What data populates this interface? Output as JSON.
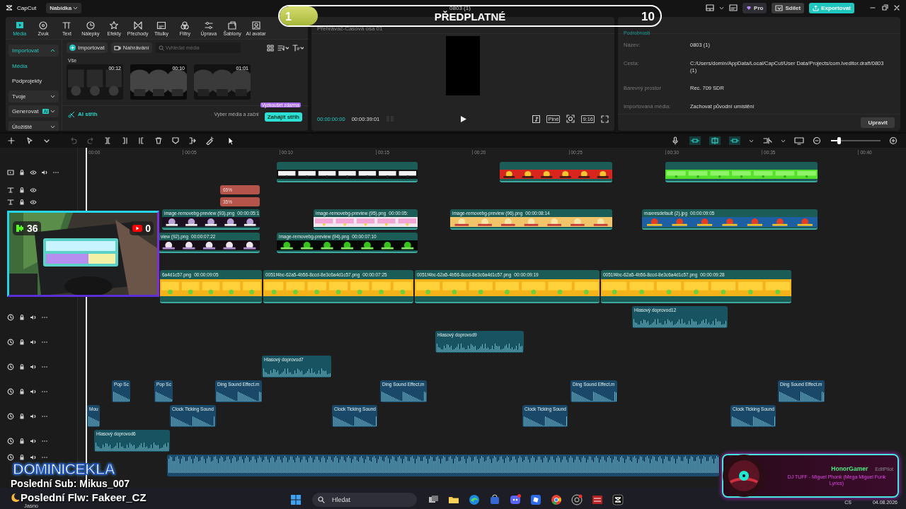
{
  "titlebar": {
    "app": "CapCut",
    "menu": "Nabídka",
    "project": "0803 (1)",
    "pro": "Pro",
    "share": "Sdílet",
    "export": "Exportovat"
  },
  "tool_tabs": [
    {
      "label": "Média",
      "selected": true
    },
    {
      "label": "Zvuk",
      "selected": false
    },
    {
      "label": "Text",
      "selected": false
    },
    {
      "label": "Nálepky",
      "selected": false
    },
    {
      "label": "Efekty",
      "selected": false
    },
    {
      "label": "Přechody",
      "selected": false
    },
    {
      "label": "Titulky",
      "selected": false
    },
    {
      "label": "Filtry",
      "selected": false
    },
    {
      "label": "Úprava",
      "selected": false
    },
    {
      "label": "Šablony",
      "selected": false
    },
    {
      "label": "AI avatar",
      "selected": false
    }
  ],
  "media_sidebar": [
    {
      "label": "Importovat",
      "kind": "group",
      "expanded": true
    },
    {
      "label": "Média",
      "kind": "item",
      "selected": true
    },
    {
      "label": "Podprojekty",
      "kind": "item",
      "selected": false
    },
    {
      "label": "Tvoje",
      "kind": "group",
      "expanded": false
    },
    {
      "label": "Generovat",
      "kind": "group",
      "expanded": false,
      "badge": "AI"
    },
    {
      "label": "Úložiště",
      "kind": "group",
      "expanded": false
    }
  ],
  "media_toolbar": {
    "import": "Importovat",
    "record": "Nahrávání",
    "search_placeholder": "Vyhledat média"
  },
  "media_filter": "Vše",
  "media_items": [
    {
      "duration": "00:12"
    },
    {
      "duration": "00:10"
    },
    {
      "duration": "01:01"
    }
  ],
  "ai_cut": {
    "label": "AI střih",
    "hint": "Vyber média a začni",
    "button": "Zahájit střih",
    "badge": "Vyzkoušet zdarma"
  },
  "player": {
    "title": "Přehrávač-Časová osa 01",
    "current_time": "00:00:00:00",
    "total_time": "00:00:39:01",
    "fit": "Plné",
    "ratio": "9:16"
  },
  "details": {
    "tab": "Podrobnosti",
    "rows": [
      {
        "label": "Název:",
        "value": "0803 (1)"
      },
      {
        "label": "Cesta:",
        "value": "C:/Users/domin/AppData/Local/CapCut/User Data/Projects/com.lveditor.draft/0803 (1)"
      },
      {
        "label": "Barevný prostor",
        "value": "Rec. 709 SDR"
      },
      {
        "label": "Importovaná média:",
        "value": "Zachovat původní umístění"
      }
    ],
    "edit_button": "Upravit"
  },
  "zoom_slider": {
    "level": 0.15
  },
  "ruler": [
    "00:00",
    "00:05",
    "00:10",
    "00:15",
    "00:20",
    "00:25",
    "00:30",
    "00:35",
    "00:40"
  ],
  "tracks": [
    {
      "kind": "video",
      "clips": [
        {
          "kind": "video"
        },
        {
          "kind": "video"
        },
        {
          "kind": "video"
        }
      ]
    },
    {
      "kind": "text",
      "clips": [
        {
          "kind": "text",
          "label": "65%"
        }
      ]
    },
    {
      "kind": "text",
      "clips": [
        {
          "kind": "text",
          "label": "35%"
        }
      ]
    },
    {
      "kind": "video",
      "clips": [
        {
          "kind": "video",
          "label": "image-removebg-preview (93).png",
          "duration": "00:00:05:1"
        },
        {
          "kind": "video",
          "label": "image-removebg-preview (95).png",
          "duration": "00:00:05:"
        },
        {
          "kind": "video",
          "label": "image-removebg-preview (96).png",
          "duration": "00:00:08:14"
        },
        {
          "kind": "video",
          "label": "maxresdefault (2).jpg",
          "duration": "00:00:09:05"
        }
      ]
    },
    {
      "kind": "video",
      "clips": [
        {
          "kind": "video",
          "label": "view (92).png",
          "duration": "00:00:07:22"
        },
        {
          "kind": "video",
          "label": "image-removebg-preview (94).png",
          "duration": "00:00:07:10"
        }
      ]
    },
    {
      "kind": "main",
      "clips": [
        {
          "kind": "video",
          "label": "6a4d1c57.png",
          "duration": "00:00:09:05"
        },
        {
          "kind": "video",
          "label": "0051f4bc-62a5-4b56-8ccd-8e3c6a4d1c57.png",
          "duration": "00:00:07:25"
        },
        {
          "kind": "video",
          "label": "0051f4bc-62a5-4b56-8ccd-8e3c6a4d1c57.png",
          "duration": "00:00:09:19"
        },
        {
          "kind": "video",
          "label": "0051f4bc-62a5-4b56-8ccd-8e3c6a4d1c57.png",
          "duration": "00:00:09:28"
        }
      ]
    },
    {
      "kind": "audio",
      "clips": [
        {
          "kind": "voice",
          "label": "Hlasový doprovod12"
        }
      ]
    },
    {
      "kind": "audio",
      "clips": [
        {
          "kind": "voice",
          "label": "Hlasový doprovod9"
        }
      ]
    },
    {
      "kind": "audio",
      "clips": [
        {
          "kind": "voice",
          "label": "Hlasový doprovod7"
        }
      ]
    },
    {
      "kind": "audio",
      "clips": [
        {
          "kind": "sound",
          "label": "Pop Sc"
        },
        {
          "kind": "sound",
          "label": "Pop Sc"
        },
        {
          "kind": "sound",
          "label": "Ding Sound Effect.m"
        },
        {
          "kind": "sound",
          "label": "Ding Sound Effect.m"
        },
        {
          "kind": "sound",
          "label": "Ding Sound Effect.m"
        },
        {
          "kind": "sound",
          "label": "Ding Sound Effect.m"
        }
      ]
    },
    {
      "kind": "audio",
      "clips": [
        {
          "kind": "sound",
          "label": "Mou"
        },
        {
          "kind": "sound",
          "label": "Clock Ticking Sound"
        },
        {
          "kind": "sound",
          "label": "Clock Ticking Sound"
        },
        {
          "kind": "sound",
          "label": "Clock Ticking Sound"
        },
        {
          "kind": "sound",
          "label": "Clock Ticking Sound"
        }
      ]
    },
    {
      "kind": "audio",
      "clips": [
        {
          "kind": "voice",
          "label": "Hlasový doprovod6"
        }
      ]
    },
    {
      "kind": "audio",
      "clips": [
        {
          "kind": "music"
        }
      ]
    }
  ],
  "stream_overlay": {
    "goal": {
      "current": "1",
      "label": "PŘEDPLATNÉ",
      "target": "10",
      "level": 0.1
    },
    "webcam": {
      "kick_count": "36",
      "youtube_count": "0"
    },
    "channel_name": "DOMINICEKLA",
    "last_sub": "Poslední Sub: Mikus_007",
    "last_follow": "Poslední Flw: Fakeer_CZ",
    "now_playing": {
      "user": "HonorGamer",
      "source": "EditPilot",
      "track": "DJ TUFF - Miguel Phonk (Mega Miguel Funk Lyrics)"
    }
  },
  "taskbar": {
    "weather": "Jasno",
    "search_placeholder": "Hledat",
    "language": "CS",
    "date": "04.08.2026"
  }
}
